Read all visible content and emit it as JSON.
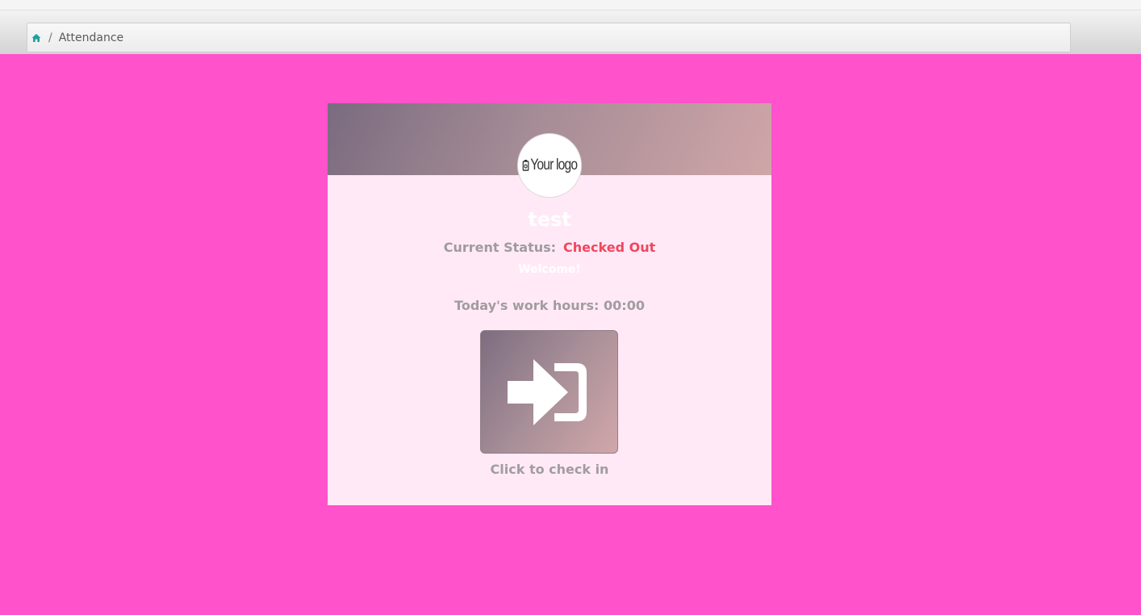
{
  "breadcrumb": {
    "home_icon": "home-icon",
    "separator": "/",
    "current": "Attendance"
  },
  "card": {
    "logo_text": "Your logo",
    "employee_name": "test",
    "status_label": "Current Status:",
    "status_value": "Checked Out",
    "welcome": "Welcome!",
    "work_hours": "Today's work hours: 00:00",
    "checkin_icon": "sign-in-icon",
    "checkin_label": "Click to check in"
  },
  "colors": {
    "background": "#ff52cb",
    "card": "#ffe9f6",
    "status_checked_out": "#f0475f",
    "breadcrumb_home": "#1aa3a3"
  }
}
